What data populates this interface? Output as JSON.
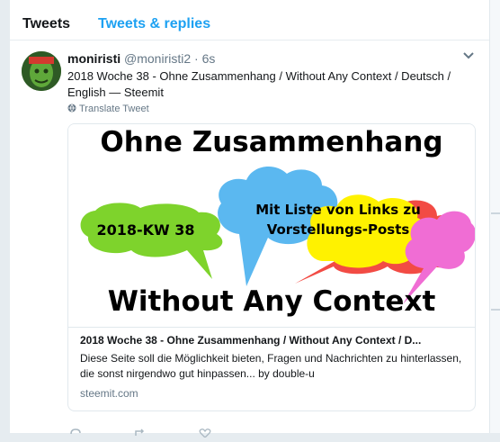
{
  "tabs": {
    "tweets": "Tweets",
    "replies": "Tweets & replies"
  },
  "tweet": {
    "name": "moniristi",
    "handle": "@moniristi2",
    "separator": "·",
    "time": "6s",
    "text": "2018 Woche 38 - Ohne Zusammenhang / Without Any Context / Deutsch / English — Steemit",
    "translate": "Translate Tweet",
    "card": {
      "image": {
        "top_text": "Ohne Zusammenhang",
        "bottom_text": "Without Any Context",
        "bubble_kw": "2018-KW 38",
        "bubble_links_1": "Mit Liste von Links zu",
        "bubble_links_2": "Vorstellungs-Posts",
        "colors": {
          "green": "#7ed32c",
          "blue": "#5bb8f0",
          "yellow": "#fff200",
          "red": "#f24b44",
          "pink": "#f06dd4"
        }
      },
      "title": "2018 Woche 38 - Ohne Zusammenhang / Without Any Context / D...",
      "description": "Diese Seite soll die Möglichkeit bieten, Fragen und Nachrichten zu hinterlassen, die sonst nirgendwo gut hinpassen... by double-u",
      "domain": "steemit.com"
    }
  },
  "colors": {
    "accent": "#1da1f2",
    "text": "#14171a",
    "muted": "#657786"
  }
}
